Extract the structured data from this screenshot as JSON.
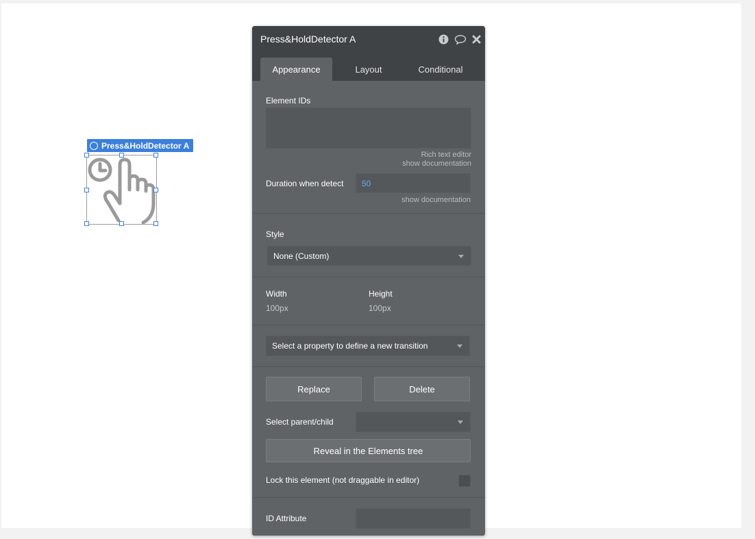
{
  "canvas_element": {
    "label": "Press&HoldDetector A",
    "icon": "press-hold-hand-icon"
  },
  "panel": {
    "title": "Press&HoldDetector A",
    "header_icons": [
      "info-icon",
      "comment-icon",
      "close-icon"
    ],
    "tabs": [
      {
        "label": "Appearance",
        "active": true
      },
      {
        "label": "Layout",
        "active": false
      },
      {
        "label": "Conditional",
        "active": false
      }
    ],
    "element_ids": {
      "label": "Element IDs",
      "value": "",
      "rich_text_link": "Rich text editor",
      "doc_link": "show documentation"
    },
    "duration": {
      "label": "Duration when detect",
      "value": "50",
      "doc_link": "show documentation"
    },
    "style": {
      "label": "Style",
      "selected": "None (Custom)"
    },
    "size": {
      "width_label": "Width",
      "width_value": "100px",
      "height_label": "Height",
      "height_value": "100px"
    },
    "transition": {
      "placeholder": "Select a property to define a new transition"
    },
    "actions": {
      "replace_label": "Replace",
      "delete_label": "Delete",
      "parent_child_label": "Select parent/child",
      "parent_child_value": "",
      "reveal_label": "Reveal in the Elements tree",
      "lock_label": "Lock this element (not draggable in editor)",
      "lock_checked": false
    },
    "id_attribute": {
      "label": "ID Attribute",
      "value": ""
    }
  },
  "colors": {
    "accent": "#3c7fdc",
    "panel_bg": "#5f6365",
    "panel_header": "#3f4345",
    "value_blue": "#6aa8f0"
  }
}
